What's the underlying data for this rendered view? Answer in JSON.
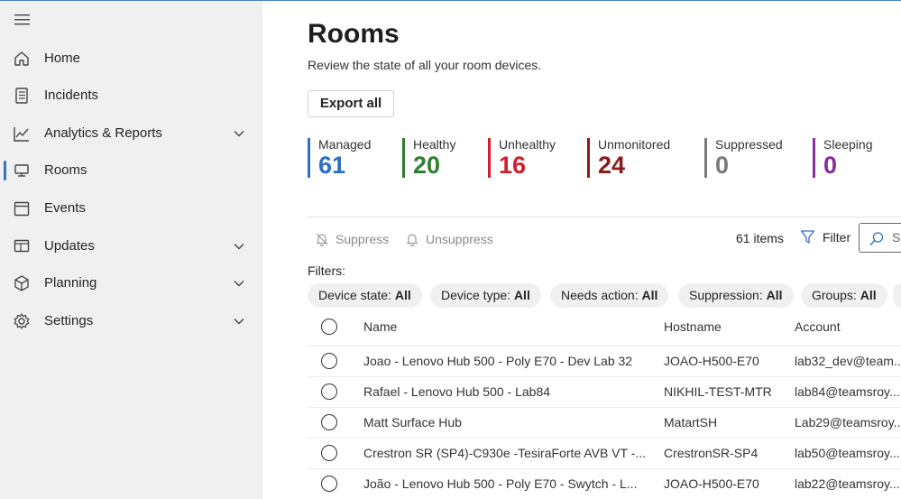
{
  "sidebar": {
    "items": [
      {
        "label": "Home",
        "icon": "home-icon",
        "has_chevron": false
      },
      {
        "label": "Incidents",
        "icon": "incidents-icon",
        "has_chevron": false
      },
      {
        "label": "Analytics & Reports",
        "icon": "analytics-icon",
        "has_chevron": true
      },
      {
        "label": "Rooms",
        "icon": "rooms-icon",
        "has_chevron": false,
        "active": true
      },
      {
        "label": "Events",
        "icon": "calendar-icon",
        "has_chevron": false
      },
      {
        "label": "Updates",
        "icon": "updates-icon",
        "has_chevron": true
      },
      {
        "label": "Planning",
        "icon": "planning-icon",
        "has_chevron": true
      },
      {
        "label": "Settings",
        "icon": "gear-icon",
        "has_chevron": true
      }
    ]
  },
  "page": {
    "title": "Rooms",
    "subtitle": "Review the state of all your room devices.",
    "export_label": "Export all"
  },
  "stats": [
    {
      "label": "Managed",
      "value": "61",
      "color": "#2f6fc2"
    },
    {
      "label": "Healthy",
      "value": "20",
      "color": "#2f7f2f"
    },
    {
      "label": "Unhealthy",
      "value": "16",
      "color": "#d0202f"
    },
    {
      "label": "Unmonitored",
      "value": "24",
      "color": "#8b1a1a"
    },
    {
      "label": "Suppressed",
      "value": "0",
      "color": "#7a7a7a"
    },
    {
      "label": "Sleeping",
      "value": "0",
      "color": "#8a2ba0"
    }
  ],
  "toolbar": {
    "suppress_label": "Suppress",
    "unsuppress_label": "Unsuppress",
    "items_count": "61 items",
    "filter_label": "Filter",
    "search_text": "S"
  },
  "filters": {
    "label": "Filters:",
    "pills": [
      {
        "name": "Device state:",
        "value": "All"
      },
      {
        "name": "Device type:",
        "value": "All"
      },
      {
        "name": "Needs action:",
        "value": "All"
      },
      {
        "name": "Suppression:",
        "value": "All"
      },
      {
        "name": "Groups:",
        "value": "All"
      }
    ]
  },
  "table": {
    "columns": [
      "Name",
      "Hostname",
      "Account"
    ],
    "rows": [
      {
        "name": "Joao - Lenovo Hub 500 - Poly E70 - Dev Lab 32",
        "hostname": "JOAO-H500-E70",
        "account": "lab32_dev@team..."
      },
      {
        "name": "Rafael - Lenovo Hub 500 - Lab84",
        "hostname": "NIKHIL-TEST-MTR",
        "account": "lab84@teamsroy..."
      },
      {
        "name": "Matt Surface Hub",
        "hostname": "MatartSH",
        "account": "Lab29@teamsroy..."
      },
      {
        "name": "Crestron SR (SP4)-C930e -TesiraForte AVB VT -...",
        "hostname": "CrestronSR-SP4",
        "account": "lab50@teamsroy..."
      },
      {
        "name": "João - Lenovo Hub 500 - Poly E70 - Swytch - L...",
        "hostname": "JOAO-H500-E70",
        "account": "lab22@teamsroy..."
      }
    ]
  }
}
